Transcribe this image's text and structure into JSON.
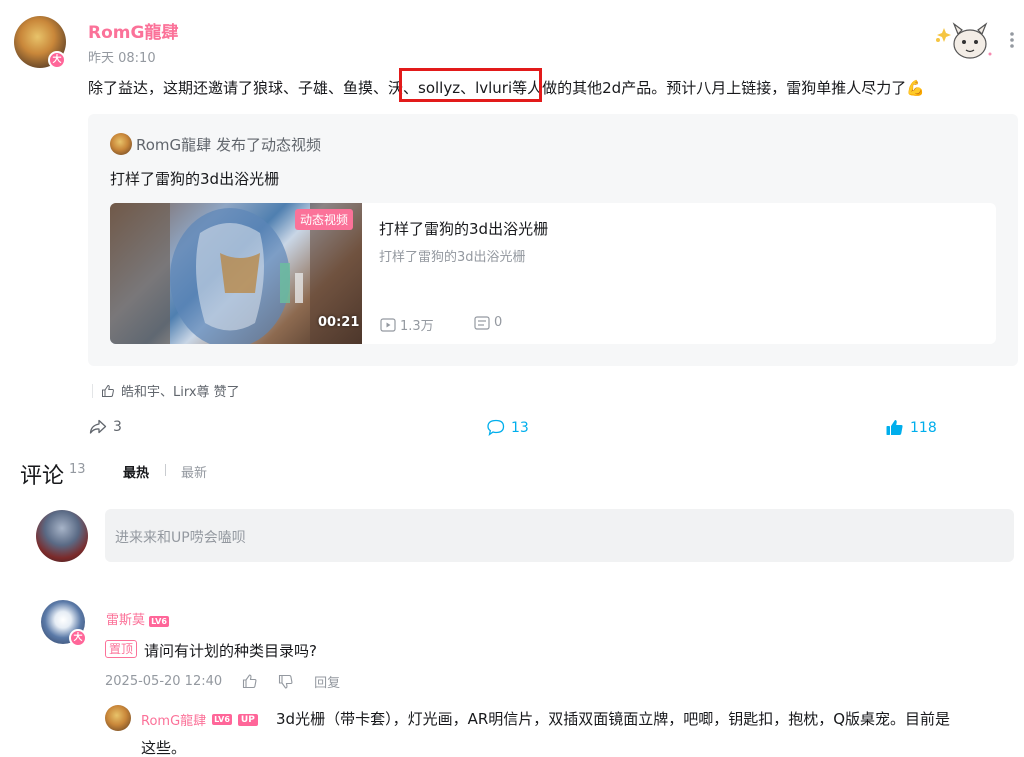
{
  "post": {
    "author": "RomG龍肆",
    "level_badge": "大",
    "time": "昨天 08:10",
    "text": "除了益达，这期还邀请了狼球、子雄、鱼摸、沃、sollyz、lvluri等人做的其他2d产品。预计八月上链接，雷狗单推人尽力了💪",
    "highlight_text": "沃、sollyz、lvluri"
  },
  "forward": {
    "author": "RomG龍肆",
    "action": "发布了动态视频",
    "title": "打样了雷狗的3d出浴光栅",
    "video": {
      "badge": "动态视频",
      "duration": "00:21",
      "title": "打样了雷狗的3d出浴光栅",
      "desc": "打样了雷狗的3d出浴光栅",
      "plays": "1.3万",
      "danmaku": "0"
    }
  },
  "liked_by": "皓和宇、Lirx尊 赞了",
  "actions": {
    "forward": "3",
    "comment": "13",
    "like": "118"
  },
  "comments": {
    "title": "评论",
    "count": "13",
    "sort_hot": "最热",
    "sort_new": "最新",
    "input_placeholder": "进来来和UP唠会嗑呗",
    "items": [
      {
        "user": "雷斯莫",
        "level": "LV6",
        "badge": "大",
        "pinned_label": "置顶",
        "text": "请问有计划的种类目录吗?",
        "time": "2025-05-20 12:40",
        "reply_label": "回复"
      }
    ],
    "reply": {
      "user": "RomG龍肆",
      "level": "LV6",
      "up_tag": "UP",
      "text_line1": "3d光栅（带卡套），灯光画，AR明信片，双插双面镜面立牌，吧唧，钥匙扣，抱枕，Q版桌宠。目前是",
      "text_line2": "这些。"
    }
  },
  "colors": {
    "pink": "#fb7299",
    "blue": "#00aeec",
    "gray": "#9499a0",
    "highlight": "#e21a1a"
  }
}
